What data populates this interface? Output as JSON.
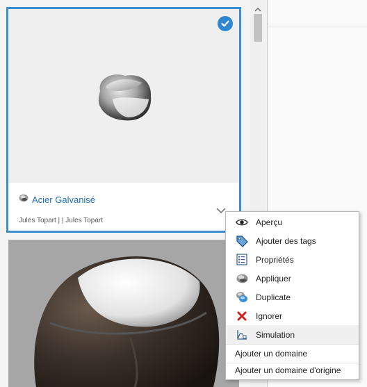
{
  "card": {
    "title": "Acier Galvanisé",
    "author": "Jules Topart |  | Jules Topart"
  },
  "menu": {
    "items": [
      {
        "label": "Aperçu",
        "icon": "eye-icon"
      },
      {
        "label": "Ajouter des tags",
        "icon": "tag-icon"
      },
      {
        "label": "Propriétés",
        "icon": "properties-icon"
      },
      {
        "label": "Appliquer",
        "icon": "apply-material-icon"
      },
      {
        "label": "Duplicate",
        "icon": "duplicate-icon"
      },
      {
        "label": "Ignorer",
        "icon": "ignore-x-icon"
      },
      {
        "label": "Simulation",
        "icon": "simulation-icon"
      },
      {
        "label": "Ajouter un domaine"
      },
      {
        "label": "Ajouter un domaine d'origine"
      }
    ]
  },
  "colors": {
    "accent": "#3a8ed2",
    "title": "#1f6fb8",
    "ignore": "#d0201c"
  }
}
